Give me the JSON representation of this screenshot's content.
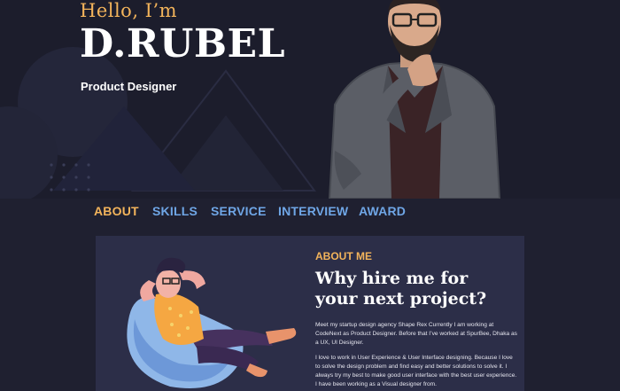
{
  "hero": {
    "greeting": "Hello, I’m",
    "name": "D.RUBEL",
    "role": "Product Designer"
  },
  "nav": {
    "items": [
      {
        "label": "ABOUT",
        "active": true
      },
      {
        "label": "SKILLS",
        "active": false
      },
      {
        "label": "SERVICE",
        "active": false
      },
      {
        "label": "INTERVIEW",
        "active": false
      },
      {
        "label": "AWARD",
        "active": false
      }
    ]
  },
  "about": {
    "eyebrow": "ABOUT ME",
    "title": "Why hire me for your next project?",
    "paragraph_1": "Meet my startup design agency Shape Rex Currently I am working at CodeNext as Product Designer. Before that I’ve worked at SpurBee, Dhaka as a UX, UI Designer.",
    "paragraph_2": "I love to work in User Experience & User Interface designing. Because I love to solve the design problem and find easy and better solutions to solve it. I always try my best to make good user interface with the best user experience. I have been working as a Visual designer from."
  },
  "colors": {
    "accent": "#f3b45b",
    "nav_link": "#6fa6e6",
    "background": "#1f2030",
    "card": "#2c2e48"
  }
}
